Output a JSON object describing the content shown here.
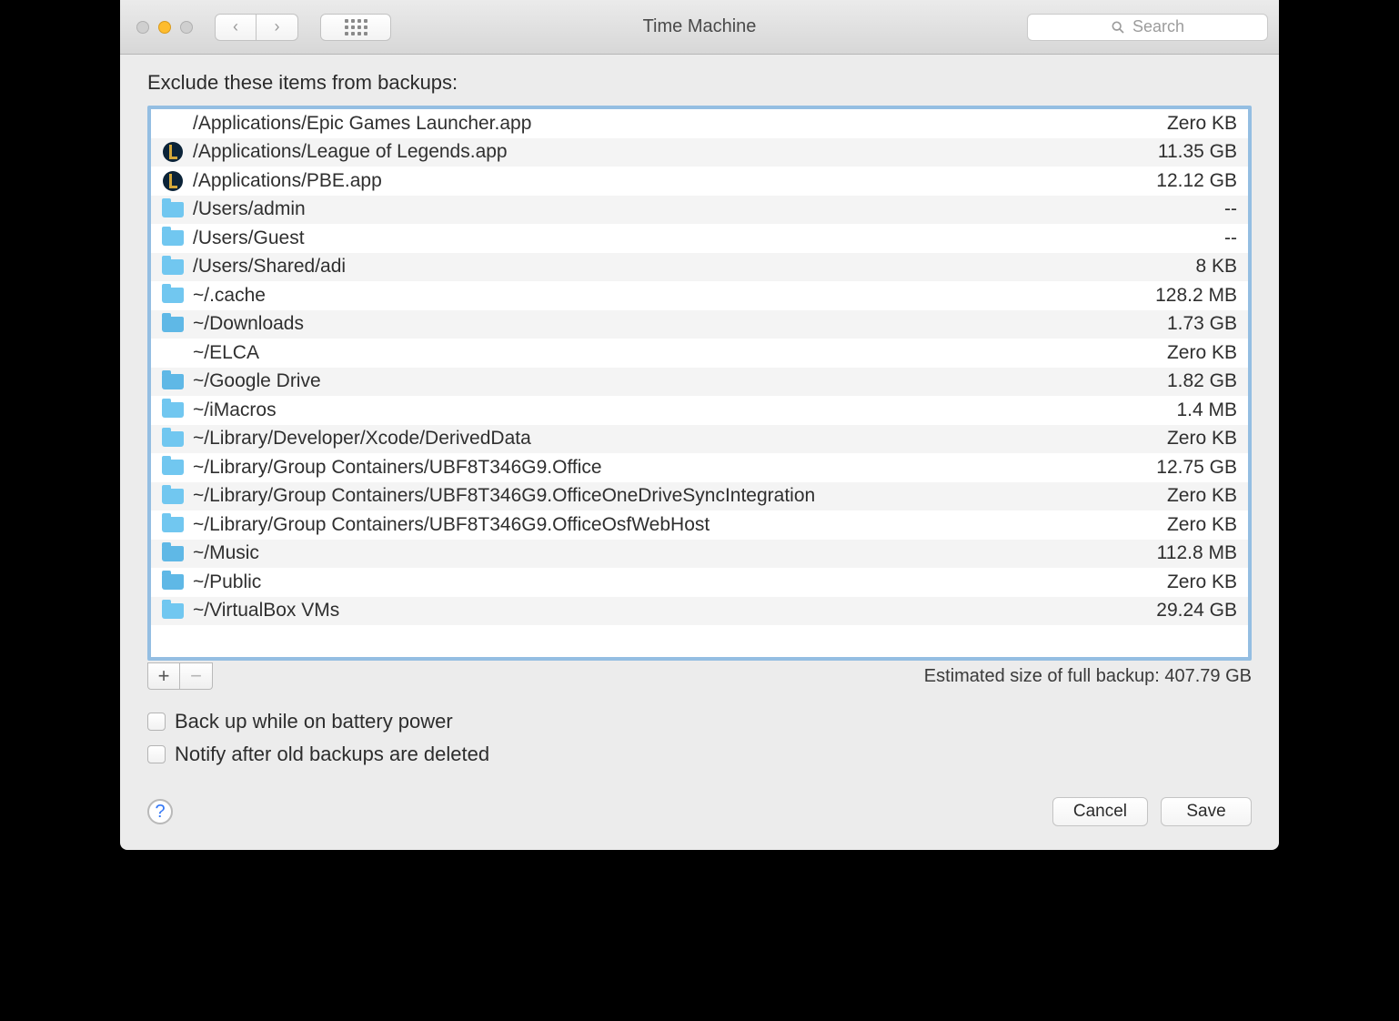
{
  "window": {
    "title": "Time Machine",
    "search_placeholder": "Search"
  },
  "heading": "Exclude these items from backups:",
  "items": [
    {
      "icon": "none",
      "path": "/Applications/Epic Games Launcher.app",
      "size": "Zero KB"
    },
    {
      "icon": "lol",
      "path": "/Applications/League of Legends.app",
      "size": "11.35 GB"
    },
    {
      "icon": "lol",
      "path": "/Applications/PBE.app",
      "size": "12.12 GB"
    },
    {
      "icon": "folder",
      "path": "/Users/admin",
      "size": "--"
    },
    {
      "icon": "folder",
      "path": "/Users/Guest",
      "size": "--"
    },
    {
      "icon": "folder",
      "path": "/Users/Shared/adi",
      "size": "8 KB"
    },
    {
      "icon": "folder",
      "path": "~/.cache",
      "size": "128.2 MB"
    },
    {
      "icon": "folder-dl",
      "path": "~/Downloads",
      "size": "1.73 GB"
    },
    {
      "icon": "none",
      "path": "~/ELCA",
      "size": "Zero KB"
    },
    {
      "icon": "folder-gd",
      "path": "~/Google Drive",
      "size": "1.82 GB"
    },
    {
      "icon": "folder",
      "path": "~/iMacros",
      "size": "1.4 MB"
    },
    {
      "icon": "folder",
      "path": "~/Library/Developer/Xcode/DerivedData",
      "size": "Zero KB"
    },
    {
      "icon": "folder",
      "path": "~/Library/Group Containers/UBF8T346G9.Office",
      "size": "12.75 GB"
    },
    {
      "icon": "folder",
      "path": "~/Library/Group Containers/UBF8T346G9.OfficeOneDriveSyncIntegration",
      "size": "Zero KB"
    },
    {
      "icon": "folder",
      "path": "~/Library/Group Containers/UBF8T346G9.OfficeOsfWebHost",
      "size": "Zero KB"
    },
    {
      "icon": "folder-mus",
      "path": "~/Music",
      "size": "112.8 MB"
    },
    {
      "icon": "folder-pub",
      "path": "~/Public",
      "size": "Zero KB"
    },
    {
      "icon": "folder",
      "path": "~/VirtualBox VMs",
      "size": "29.24 GB"
    }
  ],
  "estimate_label": "Estimated size of full backup: ",
  "estimate_value": "407.79 GB",
  "checkboxes": {
    "battery": "Back up while on battery power",
    "notify": "Notify after old backups are deleted"
  },
  "buttons": {
    "cancel": "Cancel",
    "save": "Save",
    "add": "+",
    "remove": "−",
    "help": "?"
  }
}
